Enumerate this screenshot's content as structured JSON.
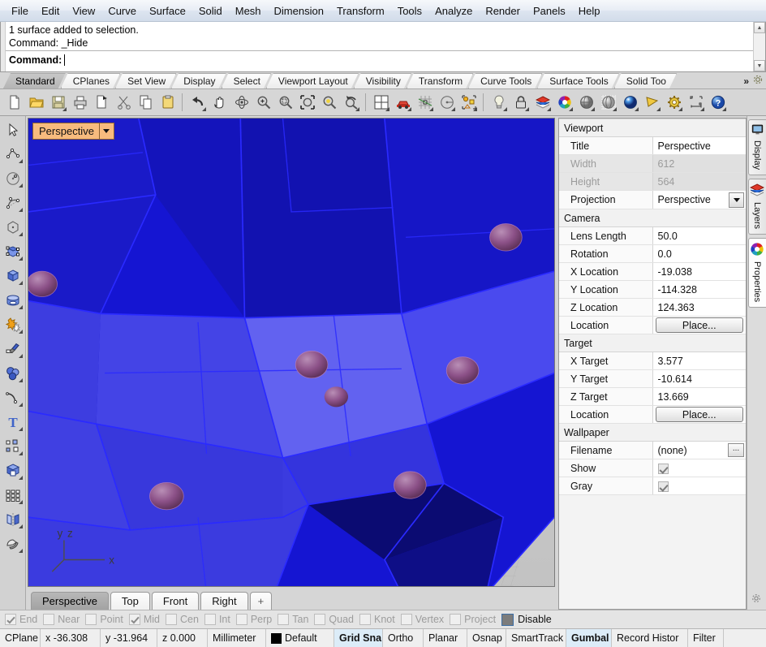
{
  "menubar": {
    "items": [
      {
        "label": "File"
      },
      {
        "label": "Edit"
      },
      {
        "label": "View"
      },
      {
        "label": "Curve"
      },
      {
        "label": "Surface"
      },
      {
        "label": "Solid"
      },
      {
        "label": "Mesh"
      },
      {
        "label": "Dimension"
      },
      {
        "label": "Transform"
      },
      {
        "label": "Tools"
      },
      {
        "label": "Analyze"
      },
      {
        "label": "Render"
      },
      {
        "label": "Panels"
      },
      {
        "label": "Help"
      }
    ]
  },
  "command_area": {
    "history": [
      "1 surface added to selection.",
      "Command: _Hide"
    ],
    "prompt_label": "Command:",
    "input_value": "",
    "input_placeholder": ""
  },
  "toolbar_tabs": {
    "items": [
      {
        "label": "Standard",
        "active": true
      },
      {
        "label": "CPlanes",
        "active": false
      },
      {
        "label": "Set View",
        "active": false
      },
      {
        "label": "Display",
        "active": false
      },
      {
        "label": "Select",
        "active": false
      },
      {
        "label": "Viewport Layout",
        "active": false
      },
      {
        "label": "Visibility",
        "active": false
      },
      {
        "label": "Transform",
        "active": false
      },
      {
        "label": "Curve Tools",
        "active": false
      },
      {
        "label": "Surface Tools",
        "active": false
      },
      {
        "label": "Solid Too",
        "active": false
      }
    ],
    "overflow_label": "»",
    "options_icon": "gear-icon"
  },
  "icon_toolbar": {
    "buttons": [
      {
        "icon": "new-file-icon",
        "flyout": false
      },
      {
        "icon": "open-folder-icon",
        "flyout": false
      },
      {
        "icon": "save-disk-icon",
        "flyout": true
      },
      {
        "icon": "print-icon",
        "flyout": false
      },
      {
        "icon": "copy-to-clipboard-icon",
        "flyout": false
      },
      {
        "icon": "cut-scissors-icon",
        "flyout": false
      },
      {
        "icon": "copy-icon",
        "flyout": false
      },
      {
        "icon": "paste-clipboard-icon",
        "flyout": false
      },
      {
        "icon": "undo-arrow-icon",
        "flyout": true
      },
      {
        "icon": "pan-hand-icon",
        "flyout": false
      },
      {
        "icon": "rotate-view-icon",
        "flyout": false
      },
      {
        "icon": "zoom-in-icon",
        "flyout": false
      },
      {
        "icon": "zoom-window-icon",
        "flyout": false
      },
      {
        "icon": "zoom-extents-icon",
        "flyout": false
      },
      {
        "icon": "zoom-selected-icon",
        "flyout": false
      },
      {
        "icon": "zoom-previous-icon",
        "flyout": true
      },
      {
        "icon": "viewport-layout-icon",
        "flyout": true
      },
      {
        "icon": "car-render-icon",
        "flyout": true
      },
      {
        "icon": "grid-snap-icon",
        "flyout": true
      },
      {
        "icon": "planar-circle-icon",
        "flyout": true
      },
      {
        "icon": "select-objects-icon",
        "flyout": true
      },
      {
        "icon": "light-bulb-icon",
        "flyout": true
      },
      {
        "icon": "lock-icon",
        "flyout": true
      },
      {
        "icon": "layers-icon",
        "flyout": true
      },
      {
        "icon": "color-wheel-icon",
        "flyout": true
      },
      {
        "icon": "shaded-sphere-icon",
        "flyout": true
      },
      {
        "icon": "ghosted-sphere-icon",
        "flyout": true
      },
      {
        "icon": "rendered-sphere-icon",
        "flyout": true
      },
      {
        "icon": "spotlight-icon",
        "flyout": true
      },
      {
        "icon": "options-gear-icon",
        "flyout": true
      },
      {
        "icon": "dimension-icon",
        "flyout": true
      },
      {
        "icon": "help-icon",
        "flyout": true
      }
    ]
  },
  "left_toolbar": {
    "buttons": [
      {
        "icon": "arrow-select-icon",
        "flyout": false
      },
      {
        "icon": "polyline-icon",
        "flyout": true
      },
      {
        "icon": "circle-icon",
        "flyout": true
      },
      {
        "icon": "curve-icon",
        "flyout": true
      },
      {
        "icon": "polygon-icon",
        "flyout": true
      },
      {
        "icon": "surface-control-points-icon",
        "flyout": true
      },
      {
        "icon": "box-solid-icon",
        "flyout": true
      },
      {
        "icon": "cylinder-icon",
        "flyout": true
      },
      {
        "icon": "boolean-union-icon",
        "flyout": true
      },
      {
        "icon": "paint-brush-icon",
        "flyout": true
      },
      {
        "icon": "sphere-group-icon",
        "flyout": true
      },
      {
        "icon": "fillet-curve-icon",
        "flyout": true
      },
      {
        "icon": "text-tool-icon",
        "flyout": true
      },
      {
        "icon": "array-icon",
        "flyout": true
      },
      {
        "icon": "boolean-difference-icon",
        "flyout": true
      },
      {
        "icon": "grid-array-icon",
        "flyout": true
      },
      {
        "icon": "mirror-icon",
        "flyout": true
      },
      {
        "icon": "split-icon",
        "flyout": true
      }
    ]
  },
  "viewport": {
    "title_label": "Perspective",
    "dropdown_icon": "chevron-down-icon",
    "axis_gizmo": {
      "x": "x",
      "y": "y",
      "z": "z"
    },
    "tabs": [
      {
        "label": "Perspective",
        "active": true
      },
      {
        "label": "Top",
        "active": false
      },
      {
        "label": "Front",
        "active": false
      },
      {
        "label": "Right",
        "active": false
      },
      {
        "label": "+",
        "active": false
      }
    ],
    "scene": {
      "object_color": "#1414d8",
      "highlight_color": "#4a4aec",
      "wire_color": "#1a1aff",
      "sphere_color": "#9a5a96",
      "ground_color": "#c9c9c9",
      "axis_line_color": "#a05a50"
    }
  },
  "properties_panel": {
    "sections": [
      {
        "title": "Viewport",
        "rows": [
          {
            "key": "Title",
            "value": "Perspective",
            "type": "text",
            "readonly": false
          },
          {
            "key": "Width",
            "value": "612",
            "type": "text",
            "readonly": true
          },
          {
            "key": "Height",
            "value": "564",
            "type": "text",
            "readonly": true
          },
          {
            "key": "Projection",
            "value": "Perspective",
            "type": "combo",
            "readonly": false
          }
        ]
      },
      {
        "title": "Camera",
        "rows": [
          {
            "key": "Lens Length",
            "value": "50.0",
            "type": "text",
            "readonly": false
          },
          {
            "key": "Rotation",
            "value": "0.0",
            "type": "text",
            "readonly": false
          },
          {
            "key": "X Location",
            "value": "-19.038",
            "type": "text",
            "readonly": false
          },
          {
            "key": "Y Location",
            "value": "-114.328",
            "type": "text",
            "readonly": false
          },
          {
            "key": "Z Location",
            "value": "124.363",
            "type": "text",
            "readonly": false
          },
          {
            "key": "Location",
            "value": "Place...",
            "type": "button",
            "readonly": false
          }
        ]
      },
      {
        "title": "Target",
        "rows": [
          {
            "key": "X Target",
            "value": "3.577",
            "type": "text",
            "readonly": false
          },
          {
            "key": "Y Target",
            "value": "-10.614",
            "type": "text",
            "readonly": false
          },
          {
            "key": "Z Target",
            "value": "13.669",
            "type": "text",
            "readonly": false
          },
          {
            "key": "Location",
            "value": "Place...",
            "type": "button",
            "readonly": false
          }
        ]
      },
      {
        "title": "Wallpaper",
        "rows": [
          {
            "key": "Filename",
            "value": "(none)",
            "type": "file",
            "readonly": false,
            "browse_label": "..."
          },
          {
            "key": "Show",
            "value": "",
            "type": "checkbox",
            "checked": true,
            "readonly": false
          },
          {
            "key": "Gray",
            "value": "",
            "type": "checkbox",
            "checked": true,
            "readonly": false
          }
        ]
      }
    ]
  },
  "right_dock": {
    "tabs": [
      {
        "label": "Display",
        "icon": "monitor-icon",
        "active": false
      },
      {
        "label": "Layers",
        "icon": "layers-icon",
        "active": false
      },
      {
        "label": "Properties",
        "icon": "color-wheel-icon",
        "active": true
      }
    ],
    "settings_icon": "gear-icon"
  },
  "osnap_bar": {
    "items": [
      {
        "label": "End",
        "checked": true
      },
      {
        "label": "Near",
        "checked": false
      },
      {
        "label": "Point",
        "checked": false
      },
      {
        "label": "Mid",
        "checked": true
      },
      {
        "label": "Cen",
        "checked": false
      },
      {
        "label": "Int",
        "checked": false
      },
      {
        "label": "Perp",
        "checked": false
      },
      {
        "label": "Tan",
        "checked": false
      },
      {
        "label": "Quad",
        "checked": false
      },
      {
        "label": "Knot",
        "checked": false
      },
      {
        "label": "Vertex",
        "checked": false
      },
      {
        "label": "Project",
        "checked": false
      }
    ],
    "disable_label": "Disable"
  },
  "status_bar": {
    "cplane_label": "CPlane",
    "x_value": "x -36.308",
    "y_value": "y -31.964",
    "z_value": "z 0.000",
    "units": "Millimeter",
    "layer_name": "Default",
    "layer_color": "#000000",
    "toggles": [
      {
        "label": "Grid Sna",
        "active": true
      },
      {
        "label": "Ortho",
        "active": false
      },
      {
        "label": "Planar",
        "active": false
      },
      {
        "label": "Osnap",
        "active": false
      },
      {
        "label": "SmartTrack",
        "active": false
      },
      {
        "label": "Gumbal",
        "active": true
      },
      {
        "label": "Record Histor",
        "active": false
      },
      {
        "label": "Filter",
        "active": false
      }
    ]
  }
}
